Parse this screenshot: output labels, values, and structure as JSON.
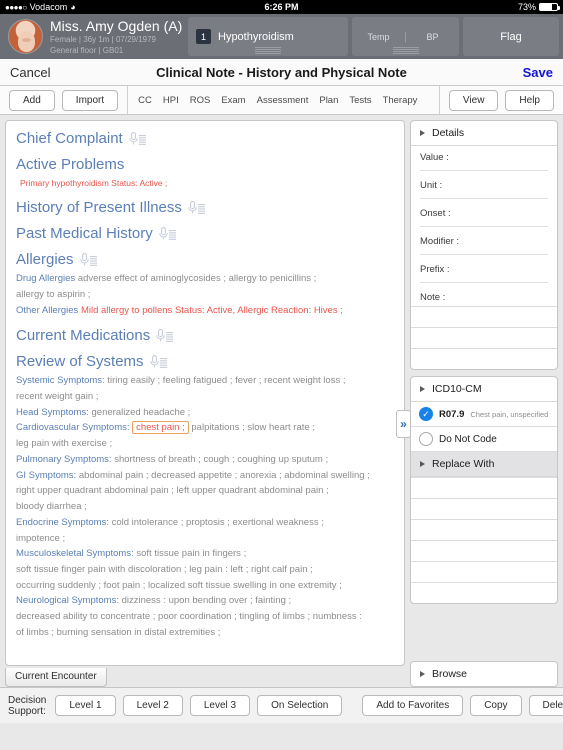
{
  "status_bar": {
    "signal_dots": "●●●●○",
    "carrier": "Vodacom",
    "wifi_icon": "wifi-icon",
    "time": "6:26 PM",
    "battery_pct": "73%"
  },
  "patient_header": {
    "avatar_icon": "patient-avatar",
    "name": "Miss. Amy Ogden (A)",
    "demographics": "Female  |  36y 1m  |  07/29/1979",
    "location": "General floor | GB01",
    "diagnosis": {
      "number": "1",
      "label": "Hypothyroidism"
    },
    "vitals": [
      "Temp",
      "BP"
    ],
    "flag_label": "Flag"
  },
  "titlebar": {
    "cancel_label": "Cancel",
    "title": "Clinical Note - History and Physical Note",
    "save_label": "Save",
    "save_color": "#1414d6"
  },
  "toolbar": {
    "add_label": "Add",
    "import_label": "Import",
    "tabs": [
      "CC",
      "HPI",
      "ROS",
      "Exam",
      "Assessment",
      "Plan",
      "Tests",
      "Therapy"
    ],
    "view_label": "View",
    "help_label": "Help"
  },
  "note": {
    "expander_icon": "chevron-double-right-icon",
    "mic_icon": "dictation-mic-icon",
    "sections": {
      "chief_complaint": "Chief Complaint",
      "active_problems": "Active Problems",
      "active_problems_text": "Primary hypothyroidism Status: Active ;",
      "hpi": "History of Present Illness",
      "pmh": "Past Medical History",
      "allergies": "Allergies",
      "drug_allergies_label": "Drug Allergies",
      "drug_allergies_text": "adverse effect of aminoglycosides ;  allergy to penicillins ;",
      "drug_allergies_text2": "allergy to aspirin ;",
      "other_allergies_label": "Other Allergies",
      "other_allergies_text": "Mild allergy to pollens Status: Active, Allergic Reaction: Hives ;",
      "current_medications": "Current Medications",
      "review_of_systems": "Review of Systems"
    },
    "ros": [
      {
        "label": "Systemic Symptoms:",
        "lines": [
          "tiring easily ;  feeling fatigued ;  fever ;  recent weight loss ;",
          "recent weight gain ;"
        ]
      },
      {
        "label": "Head Symptoms:",
        "lines": [
          "generalized headache ;"
        ]
      },
      {
        "label": "Cardiovascular Symptoms:",
        "highlight": "chest pain ;",
        "lines": [
          "palpitations ;  slow heart rate ;",
          "leg pain with exercise ;"
        ]
      },
      {
        "label": "Pulmonary Symptoms:",
        "lines": [
          "shortness of breath ;  cough ;  coughing up sputum ;"
        ]
      },
      {
        "label": "GI Symptoms:",
        "lines": [
          "abdominal pain ;  decreased appetite ;  anorexia ;  abdominal swelling ;",
          "right upper quadrant abdominal pain ;  left upper quadrant abdominal pain ;",
          "bloody diarrhea ;"
        ]
      },
      {
        "label": "Endocrine Symptoms:",
        "lines": [
          "cold intolerance ;  proptosis ;  exertional weakness ;",
          "impotence ;"
        ]
      },
      {
        "label": "Musculoskeletal Symptoms:",
        "lines": [
          "soft tissue pain in fingers ;",
          "soft tissue finger pain with discoloration ;  leg pain : left ;  right calf pain ;",
          "occurring suddenly ;  foot pain ;  localized soft tissue swelling in one extremity ;"
        ]
      },
      {
        "label": "Neurological Symptoms:",
        "lines": [
          "dizziness : upon bending over ;  fainting ;",
          "decreased ability to concentrate ;  poor coordination ;  tingling of limbs ;  numbness :",
          "of limbs ;  burning sensation in distal extremities ;"
        ]
      }
    ],
    "encounter_tab": "Current Encounter"
  },
  "details_panel": {
    "title": "Details",
    "fields": [
      "Value :",
      "Unit :",
      "Onset :",
      "Modifier :",
      "Prefix :",
      "Note :"
    ]
  },
  "icd_panel": {
    "title": "ICD10-CM",
    "selected_code": "R07.9",
    "selected_desc": "Chest pain, unspecified",
    "selected_color": "#1782e8",
    "do_not_code_label": "Do Not Code",
    "replace_with_label": "Replace With"
  },
  "browse_panel": {
    "title": "Browse"
  },
  "bottom_bar": {
    "decision_support_label": "Decision Support:",
    "levels": [
      "Level 1",
      "Level 2",
      "Level 3",
      "On Selection"
    ],
    "actions": [
      "Add to Favorites",
      "Copy",
      "Delete"
    ],
    "mic_icon": "microphone-icon"
  }
}
